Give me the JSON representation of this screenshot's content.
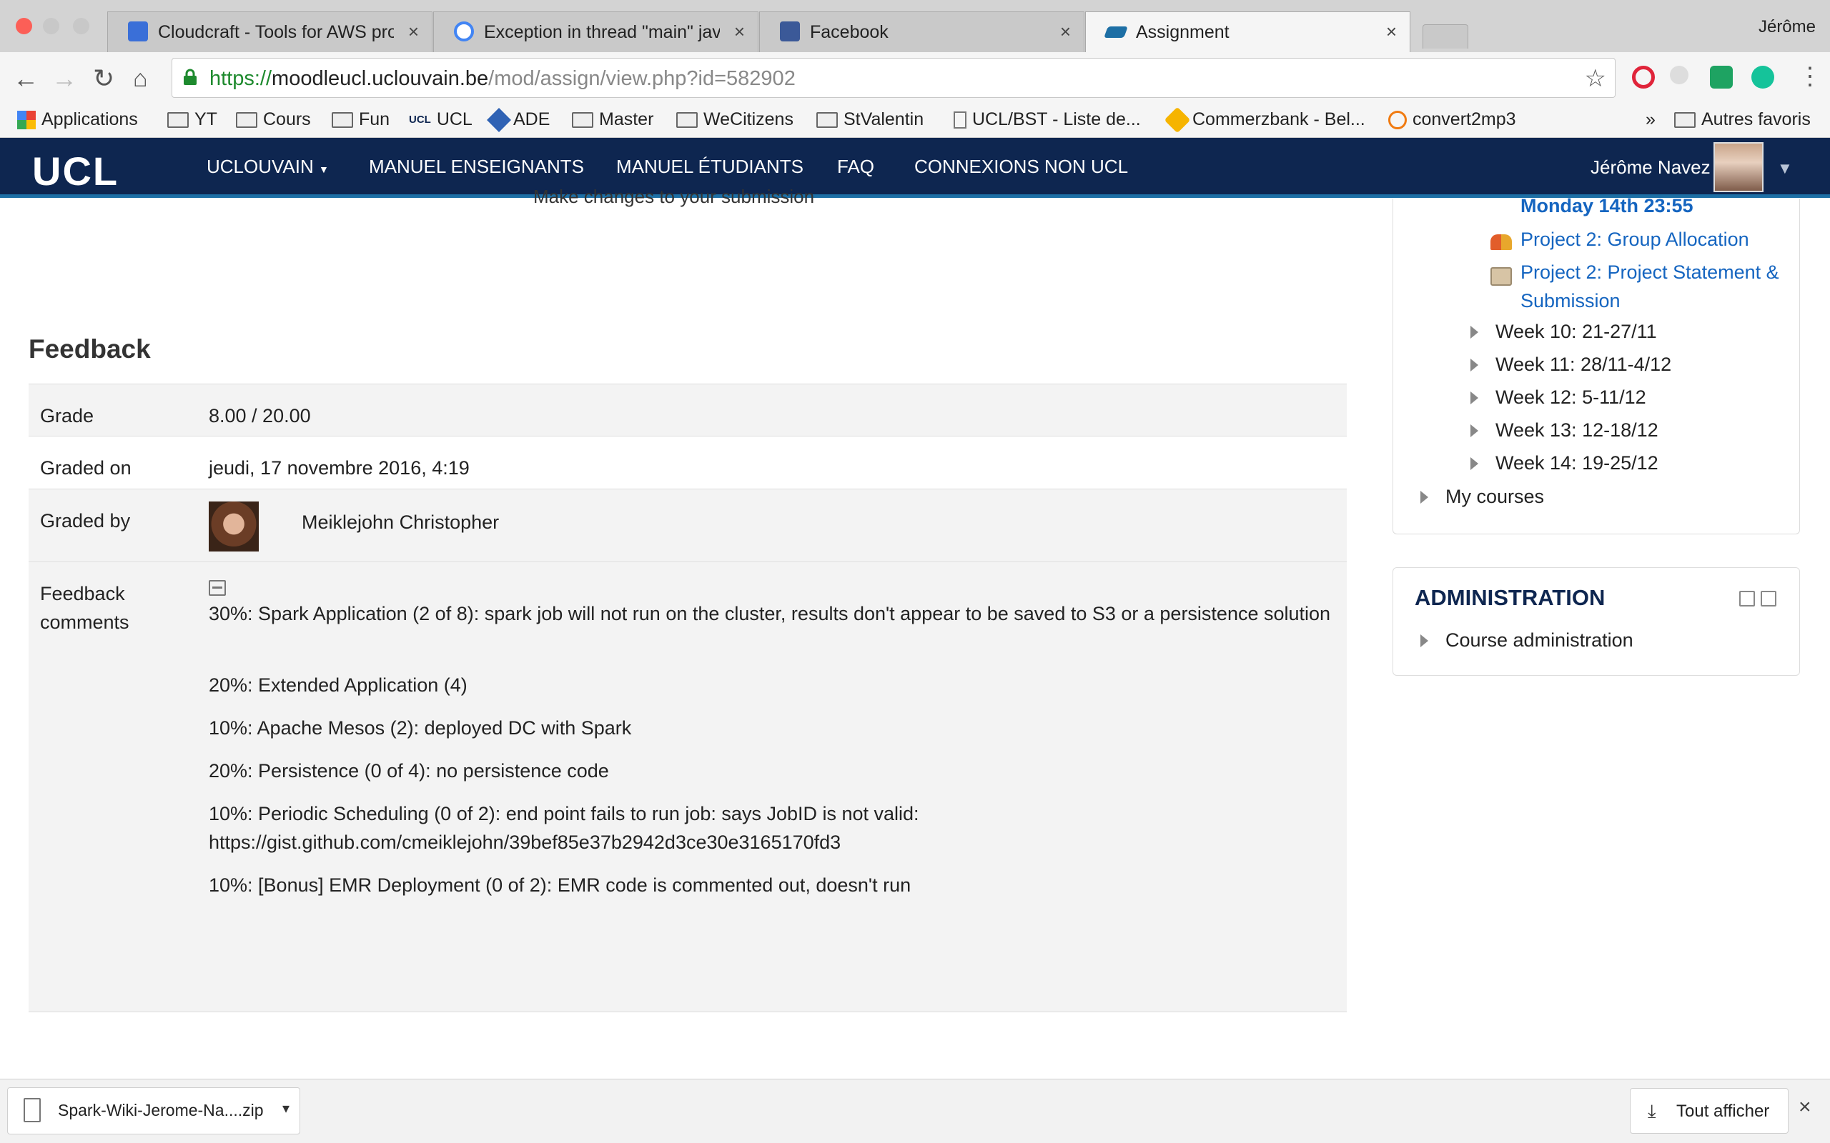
{
  "browser": {
    "tabs": [
      {
        "title": "Cloudcraft - Tools for AWS pro",
        "favicon_color": "#3a6fd8"
      },
      {
        "title": "Exception in thread \"main\" java",
        "favicon_color": "#4285f4"
      },
      {
        "title": "Facebook",
        "favicon_color": "#3b5998"
      },
      {
        "title": "Assignment",
        "favicon_color": "#1d6fa5"
      }
    ],
    "profile_name": "Jérôme",
    "url_scheme": "https://",
    "url_host": "moodleucl.uclouvain.be",
    "url_path": "/mod/assign/view.php?id=582902",
    "bookmarks": [
      "Applications",
      "YT",
      "Cours",
      "Fun",
      "UCL",
      "ADE",
      "Master",
      "WeCitizens",
      "StValentin",
      "UCL/BST - Liste de...",
      "Commerzbank - Bel...",
      "convert2mp3"
    ],
    "bookmarks_overflow": "»",
    "other_bookmarks": "Autres favoris",
    "ucl_small_logo": "UCL"
  },
  "navbar": {
    "logo": "UCL",
    "menu": [
      "UCLOUVAIN",
      "MANUEL ENSEIGNANTS",
      "MANUEL ÉTUDIANTS",
      "FAQ",
      "CONNEXIONS NON UCL"
    ],
    "user_name": "Jérôme Navez"
  },
  "main": {
    "prev_link": "Make changes to your submission",
    "feedback_heading": "Feedback",
    "rows": {
      "grade_label": "Grade",
      "grade_value": "8.00 / 20.00",
      "graded_on_label": "Graded on",
      "graded_on_value": "jeudi, 17 novembre 2016, 4:19",
      "graded_by_label": "Graded by",
      "graded_by_value": "Meiklejohn Christopher",
      "comments_label": "Feedback comments"
    },
    "comments": [
      "30%: Spark Application (2 of 8): spark job will not run on the cluster, results don't appear to be saved to S3 or a persistence solution",
      "20%: Extended Application (4)",
      "10%: Apache Mesos (2): deployed DC with Spark",
      "20%: Persistence (0 of 4): no persistence code",
      "10%: Periodic Scheduling (0 of 2): end point fails to run job: says JobID is not valid: https://gist.github.com/cmeiklejohn/39bef85e37b2942d3ce30e3165170fd3",
      "10%: [Bonus] EMR Deployment (0 of 2): EMR code is commented out, doesn't run"
    ]
  },
  "sidebar": {
    "partial_date": "Monday 14th 23:55",
    "links": [
      "Project 2: Group Allocation",
      "Project 2: Project Statement & Submission"
    ],
    "weeks": [
      "Week 10: 21-27/11",
      "Week 11: 28/11-4/12",
      "Week 12: 5-11/12",
      "Week 13: 12-18/12",
      "Week 14: 19-25/12"
    ],
    "my_courses": "My courses",
    "admin_heading": "ADMINISTRATION",
    "admin_item": "Course administration"
  },
  "downloads": {
    "file_name": "Spark-Wiki-Jerome-Na....zip",
    "show_all": "Tout afficher"
  },
  "colors": {
    "navbar": "#0e2650",
    "link": "#1565c0",
    "accent": "#1d6fa5"
  }
}
